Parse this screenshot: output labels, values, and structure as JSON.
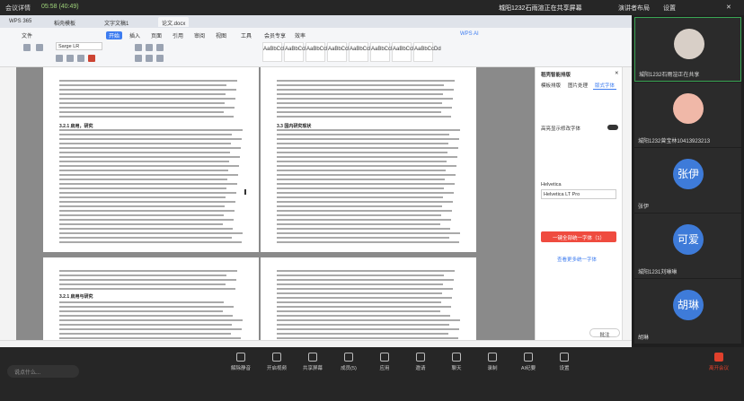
{
  "meeting_bar": {
    "app_label": "会议详情",
    "stream_label": "05:58 (40:49)",
    "topic": "城阳1232石雨渲正在共享屏幕",
    "gallery_label": "演讲者布局",
    "settings_label": "设置"
  },
  "app": {
    "tabs": [
      "WPS 365",
      "稻壳模板",
      "文字文稿1",
      "论文.docx"
    ],
    "menus": [
      "文件",
      "开始",
      "插入",
      "页面",
      "引用",
      "审阅",
      "视图",
      "工具",
      "会员专享",
      "效率",
      "WPS AI"
    ],
    "active_menu": "开始",
    "font_name": "Sarge LR",
    "styles": [
      "AaBbCcDd",
      "AaBbCcDd",
      "AaBbCcDd",
      "AaBbCcDd",
      "AaBbCcDd",
      "AaBbCcDd",
      "AaBbCcDd",
      "AaBbCcDd"
    ],
    "panel": {
      "title": "稻壳智能排版",
      "tabs": [
        "模板排版",
        "图片处理",
        "版式字体"
      ],
      "option": "高亮显示修改字体",
      "font_label": "Helvetica",
      "font_value": "Helvetica LT Pro",
      "primary_button": "一键全部统一字体（1）",
      "link": "查看更多统一字体"
    },
    "doc_headings": [
      "3.2.1 启用，研究",
      "3.3 国内研究现状",
      "3.2.1 启用与研究"
    ],
    "sidebar_buttons": [
      "批注",
      "修订"
    ]
  },
  "participants": [
    {
      "name": "城阳1232石雨渲正在共享",
      "type": "photo",
      "color": "#d8cfc7"
    },
    {
      "name": "城阳1232曾宝林10413923213",
      "type": "cartoon",
      "color": "#f0b8a8"
    },
    {
      "name": "张伊",
      "type": "text",
      "text": "张伊",
      "color": "#3e7bd9"
    },
    {
      "name": "城阳1231刘琳琳",
      "type": "text",
      "text": "可爱",
      "color": "#3e7bd9"
    },
    {
      "name": "胡琳",
      "type": "text",
      "text": "胡琳",
      "color": "#3e7bd9"
    }
  ],
  "bottom_toolbar": {
    "input_placeholder": "说点什么...",
    "buttons": [
      "解除静音",
      "开启视频",
      "共享屏幕",
      "成员(5)",
      "应用",
      "邀请",
      "聊天",
      "录制",
      "AI纪要",
      "设置"
    ],
    "end_label": "离开会议"
  },
  "colors": {
    "accent": "#3d7cf0",
    "end_red": "#e0402c",
    "panel_button": "#ef4b3f"
  }
}
